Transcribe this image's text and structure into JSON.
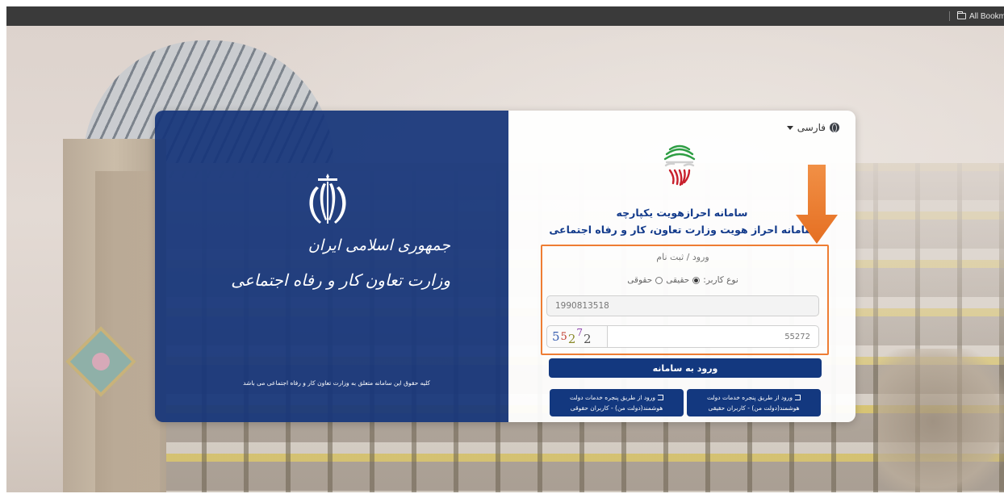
{
  "browser": {
    "bookmarks_label": "All Bookmarks"
  },
  "brand": {
    "gov_title": "جمهوری اسلامی ایران",
    "ministry_title": "وزارت تعاون کار و رفاه اجتماعی",
    "copyright": "کلیه حقوق این سامانه متعلق به وزارت تعاون کار و رفاه اجتماعی می باشد"
  },
  "login": {
    "language": "فارسی",
    "title": "سامانه احرازهویت یکپارچه",
    "subtitle": "سامانه احراز هویت وزارت تعاون، کار و رفاه اجتماعی",
    "section_label": "ورود / ثبت نام",
    "user_type_label": "نوع کاربر:",
    "user_type_options": [
      "حقیقی",
      "حقوقی"
    ],
    "user_type_selected": "حقیقی",
    "national_id_value": "1990813518",
    "captcha_image_text": [
      "5",
      "5",
      "2",
      "7",
      "2"
    ],
    "captcha_value": "55272",
    "submit_label": "ورود به سامانه",
    "dolat_real_label": "ورود از طریق پنجره خدمات دولت هوشمند(دولت من) - کاربران حقیقی",
    "dolat_legal_label": "ورود از طریق پنجره خدمات دولت هوشمند(دولت من) - کاربران حقوقی"
  },
  "colors": {
    "brand_blue": "#13387f",
    "title_blue": "#123a8b",
    "annotation_orange": "#ee7d33"
  }
}
